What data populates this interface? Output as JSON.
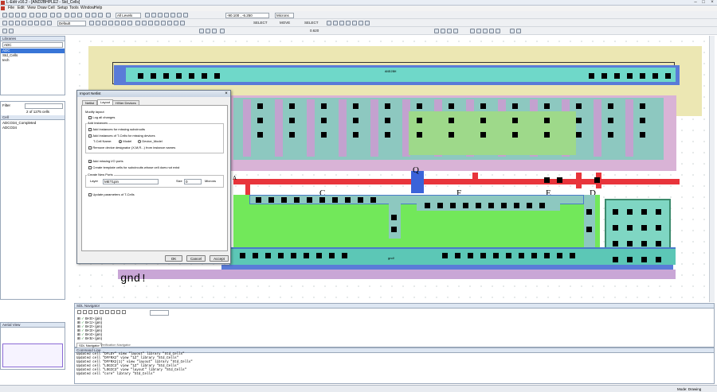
{
  "window": {
    "title": "L-Edit v16.2 - [AND2BHPLE2 - Std_Cells]"
  },
  "menu": [
    "File",
    "Edit",
    "View",
    "Draw",
    "Cell",
    "Setup",
    "Tools",
    "Window",
    "Help"
  ],
  "toolbar": {
    "style_value": "Default",
    "layers_value": "All Levels",
    "coords_value": "-90.100 , -6.250",
    "units_value": "Microns",
    "select_1": "SELECT",
    "move": "MOVE",
    "select_2": "SELECT",
    "zoom_value": "0.620"
  },
  "libraries": {
    "title": "Libraries",
    "selected_library": "ADC",
    "items": [
      "ADC",
      "Std_Cells",
      "tech"
    ]
  },
  "cells": {
    "filter_label": "Filter",
    "count": "2 of 1275 cells",
    "header": "Cell",
    "items": [
      "ADCO34_Completed",
      "ADCO34"
    ]
  },
  "aerial": {
    "title": "Aerial View"
  },
  "canvas": {
    "text_gnd": "gnd!",
    "label_top": "AND2BH",
    "label_gnd_small": "gnd!",
    "pin_c": "C",
    "pin_q": "Q",
    "pin_f": "F",
    "pin_e": "E",
    "pin_d": "D",
    "pin_a": "A"
  },
  "dialog": {
    "title": "Import Netlist",
    "tabs": [
      "Netlist",
      "Layout",
      "H/Ner Devices"
    ],
    "modify_layout": "Modify layout",
    "log_changes": "Log all changes",
    "add_instances": "Add instances",
    "add_missing_subckt": "Add instances for missing subcircuits",
    "add_tcells": "Add instances of T-Cells for missing devices",
    "tcell_name_label": "T-Cell Name:",
    "model_label": "Model",
    "device_model_label": "Device_Model",
    "remove_designator": "Remove device designator (X,M,R...) from instance names",
    "add_io_ports": "Add missing I/O ports",
    "create_template": "Create template cells for subcircuits whose cell does not exist",
    "create_new_ports": "Create New Ports",
    "layer_label": "Layer",
    "layer_value": "MET1pin",
    "size_label": "Size",
    "size_value": "0",
    "size_unit": "Microns",
    "update_params": "Update parameters of T-Cells",
    "ok": "OK",
    "cancel": "Cancel",
    "accept": "Accept"
  },
  "sdl": {
    "title": "SDL Navigator",
    "tabs": [
      "SDL Navigator",
      "Verification Navigator"
    ],
    "rows": [
      "B<0> (pin)",
      "B<1> (pin)",
      "B<2> (pin)",
      "B<3> (pin)",
      "B<4> (pin)",
      "B<5> (pin)"
    ]
  },
  "command": {
    "title": "Command Line",
    "lines": [
      "Updated cell \"DFLDY\" view \"layout\" library \"Std_Cells\"",
      "Updated cell \"DFFRX2\" view \"1Z\" library \"Std_Cells\"",
      "Updated cell \"DFFRX2(1)\" view \"layout\" library \"Std_Cells\"",
      "Updated cell \"LOGIC3\" view \"1Z\" library \"Std_Cells\"",
      "Updated cell \"LOGIC3\" view \"layout\" library \"Std_Cells\"",
      "Updated cell \"core\" library \"Std_Cells\""
    ]
  },
  "status": {
    "mode": "Mode: Drawing"
  },
  "colors": {
    "metal1": "#5c8fd6",
    "diff": "#6ee7b7",
    "poly": "#e8343b",
    "nwell": "#e7e0a8",
    "pselect": "#b784c9",
    "green": "#79e35a"
  }
}
